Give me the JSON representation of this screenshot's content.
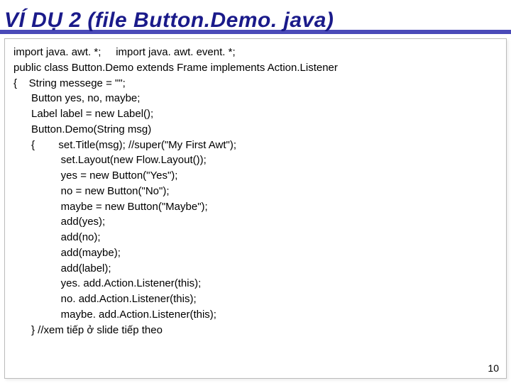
{
  "title": "VÍ DỤ 2 (file Button.Demo. java)",
  "page_number": "10",
  "code_lines": [
    "import java. awt. *;     import java. awt. event. *;",
    "public class Button.Demo extends Frame implements Action.Listener",
    "{    String messege = \"\";",
    "      Button yes, no, maybe;",
    "      Label label = new Label();",
    "      Button.Demo(String msg)",
    "      {        set.Title(msg); //super(\"My First Awt\");",
    "                set.Layout(new Flow.Layout());",
    "                yes = new Button(\"Yes\");",
    "                no = new Button(\"No\");",
    "                maybe = new Button(\"Maybe\");",
    "                add(yes);",
    "                add(no);",
    "                add(maybe);",
    "                add(label);",
    "                yes. add.Action.Listener(this);",
    "                no. add.Action.Listener(this);",
    "                maybe. add.Action.Listener(this);",
    "      } //xem tiếp ở slide tiếp theo"
  ]
}
